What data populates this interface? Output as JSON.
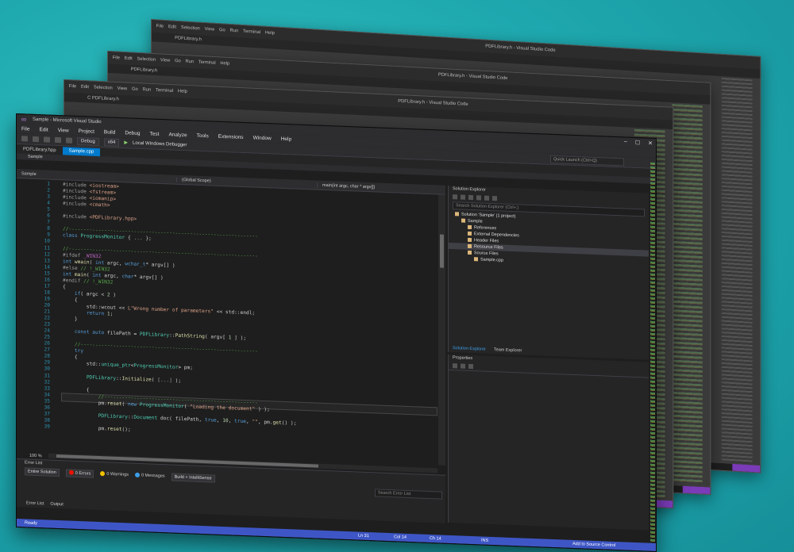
{
  "bg_windows": [
    {
      "tab": "PDFLibrary.h",
      "title": "PDFLibrary.h - Visual Studio Code",
      "menu": [
        "File",
        "Edit",
        "Selection",
        "View",
        "Go",
        "Run",
        "Terminal",
        "Help"
      ]
    },
    {
      "tab": "PDFLibrary.h",
      "title": "PDFLibrary.h - Visual Studio Code",
      "menu": [
        "File",
        "Edit",
        "Selection",
        "View",
        "Go",
        "Run",
        "Terminal",
        "Help"
      ]
    },
    {
      "tab": "C PDFLibrary.h",
      "title": "PDFLibrary.h - Visual Studio Code",
      "menu": [
        "File",
        "Edit",
        "Selection",
        "View",
        "Go",
        "Run",
        "Terminal",
        "Help"
      ]
    }
  ],
  "main": {
    "title": "Sample - Microsoft Visual Studio",
    "menu": [
      "File",
      "Edit",
      "View",
      "Project",
      "Build",
      "Debug",
      "Test",
      "Analyze",
      "Tools",
      "Extensions",
      "Window",
      "Help"
    ],
    "toolbar": {
      "config": "Debug",
      "platform": "x64",
      "run_label": "Local Windows Debugger",
      "search_placeholder": "Quick Launch (Ctrl+Q)"
    },
    "tabs": [
      {
        "label": "PDFLibrary.hpp"
      },
      {
        "label": "Sample.cpp"
      }
    ],
    "subtab": "Sample",
    "nav": {
      "scope": "(Global Scope)",
      "member": "main(int argc, char * argv[])"
    },
    "code_lines": [
      {
        "n": "1",
        "html": "<span class='pp'>#include</span> <span class='st'>&lt;iostream&gt;</span>"
      },
      {
        "n": "2",
        "html": "<span class='pp'>#include</span> <span class='st'>&lt;fstream&gt;</span>"
      },
      {
        "n": "3",
        "html": "<span class='pp'>#include</span> <span class='st'>&lt;iomanip&gt;</span>"
      },
      {
        "n": "4",
        "html": "<span class='pp'>#include</span> <span class='st'>&lt;cmath&gt;</span>"
      },
      {
        "n": "5",
        "html": ""
      },
      {
        "n": "6",
        "html": "<span class='pp'>#include</span> <span class='st'>&lt;PDFLibrary.hpp&gt;</span>"
      },
      {
        "n": "7",
        "html": ""
      },
      {
        "n": "8",
        "html": "<span class='cm'>//----------------------------------------------------------------</span>"
      },
      {
        "n": "9",
        "html": "<span class='kw'>class</span> <span class='ty'>ProgressMonitor</span> { <span class='pp'>...</span> };"
      },
      {
        "n": "10",
        "html": ""
      },
      {
        "n": "11",
        "html": "<span class='cm'>//----------------------------------------------------------------</span>"
      },
      {
        "n": "12",
        "html": "<span class='pp'>#ifdef</span> <span class='mc'>_WIN32</span>"
      },
      {
        "n": "13",
        "html": "<span class='kw'>int</span> <span class='fn'>wmain</span>( <span class='kw'>int</span> argc, <span class='kw'>wchar_t</span>* argv[] )"
      },
      {
        "n": "14",
        "html": "<span class='pp'>#else</span> <span class='cm'>// !_WIN32</span>"
      },
      {
        "n": "15",
        "html": "<span class='kw'>int</span> <span class='fn'>main</span>( <span class='kw'>int</span> argc, <span class='kw'>char</span>* argv[] )"
      },
      {
        "n": "16",
        "html": "<span class='pp'>#endif</span> <span class='cm'>// !_WIN32</span>"
      },
      {
        "n": "17",
        "html": "{"
      },
      {
        "n": "18",
        "html": "    <span class='kw'>if</span>( argc &lt; <span class='nm'>2</span> )"
      },
      {
        "n": "19",
        "html": "    {"
      },
      {
        "n": "20",
        "html": "        std::wcout &lt;&lt; <span class='st'>L\"Wrong number of parameters\"</span> &lt;&lt; std::endl;"
      },
      {
        "n": "21",
        "html": "        <span class='kw'>return</span> <span class='nm'>1</span>;"
      },
      {
        "n": "22",
        "html": "    }"
      },
      {
        "n": "23",
        "html": ""
      },
      {
        "n": "24",
        "html": "    <span class='kw'>const</span> <span class='kw'>auto</span> filePath = <span class='ty'>PDFLibrary</span>::<span class='fn'>PathString</span>( argv[ <span class='nm'>1</span> ] );"
      },
      {
        "n": "25",
        "html": ""
      },
      {
        "n": "26",
        "html": "    <span class='cm'>//------------------------------------------------------------</span>"
      },
      {
        "n": "27",
        "html": "    <span class='kw'>try</span>"
      },
      {
        "n": "28",
        "html": "    {"
      },
      {
        "n": "29",
        "html": "        std::<span class='ty'>unique_ptr</span>&lt;<span class='ty'>ProgressMonitor</span>&gt; pm;"
      },
      {
        "n": "30",
        "html": ""
      },
      {
        "n": "31",
        "html": "        <span class='ty'>PDFLibrary</span>::<span class='fn'>Initialize</span>( <span class='pp'>[...]</span> );"
      },
      {
        "n": "32",
        "html": ""
      },
      {
        "n": "33",
        "html": "        {"
      },
      {
        "n": "34",
        "html": "            <span class='cm'>//----------------------------------------------------</span>"
      },
      {
        "n": "35",
        "html": "            pm.<span class='fn'>reset</span>( <span class='kw'>new</span> <span class='ty'>ProgressMonitor</span>( <span class='st'>\"Loading the document\"</span> ) );"
      },
      {
        "n": "36",
        "html": ""
      },
      {
        "n": "37",
        "html": "            <span class='ty'>PDFLibrary</span>::<span class='ty'>Document</span> doc( filePath, <span class='kw'>true</span>, <span class='nm'>10</span>, <span class='kw'>true</span>, <span class='st'>\"\"</span>, pm.<span class='fn'>get</span>() );"
      },
      {
        "n": "38",
        "html": ""
      },
      {
        "n": "39",
        "html": "            pm.<span class='fn'>reset</span>();"
      }
    ],
    "zoom": "100 %",
    "error_list": {
      "title": "Error List",
      "scope": "Entire Solution",
      "errors": "0 Errors",
      "warnings": "0 Warnings",
      "messages": "0 Messages",
      "filter": "Build + IntelliSense",
      "search": "Search Error List",
      "tabs": [
        "Error List",
        "Output"
      ]
    },
    "solution": {
      "title": "Solution Explorer",
      "search": "Search Solution Explorer (Ctrl+;)",
      "tree": [
        {
          "indent": 1,
          "label": "Solution 'Sample' (1 project)",
          "sel": false
        },
        {
          "indent": 2,
          "label": "Sample",
          "sel": false
        },
        {
          "indent": 3,
          "label": "References",
          "sel": false
        },
        {
          "indent": 3,
          "label": "External Dependencies",
          "sel": false
        },
        {
          "indent": 3,
          "label": "Header Files",
          "sel": false
        },
        {
          "indent": 3,
          "label": "Resource Files",
          "sel": true
        },
        {
          "indent": 3,
          "label": "Source Files",
          "sel": false
        },
        {
          "indent": 4,
          "label": "Sample.cpp",
          "sel": false
        }
      ],
      "tabs": [
        "Solution Explorer",
        "Team Explorer"
      ]
    },
    "properties_title": "Properties",
    "status": {
      "ready": "Ready",
      "ln": "Ln 31",
      "col": "Col 14",
      "ch": "Ch 14",
      "ins": "INS",
      "source_control": "Add to Source Control"
    },
    "colors": {
      "accent": "#007acc",
      "status_bar": "#3e56c5",
      "background": "#1fa9b0"
    }
  }
}
